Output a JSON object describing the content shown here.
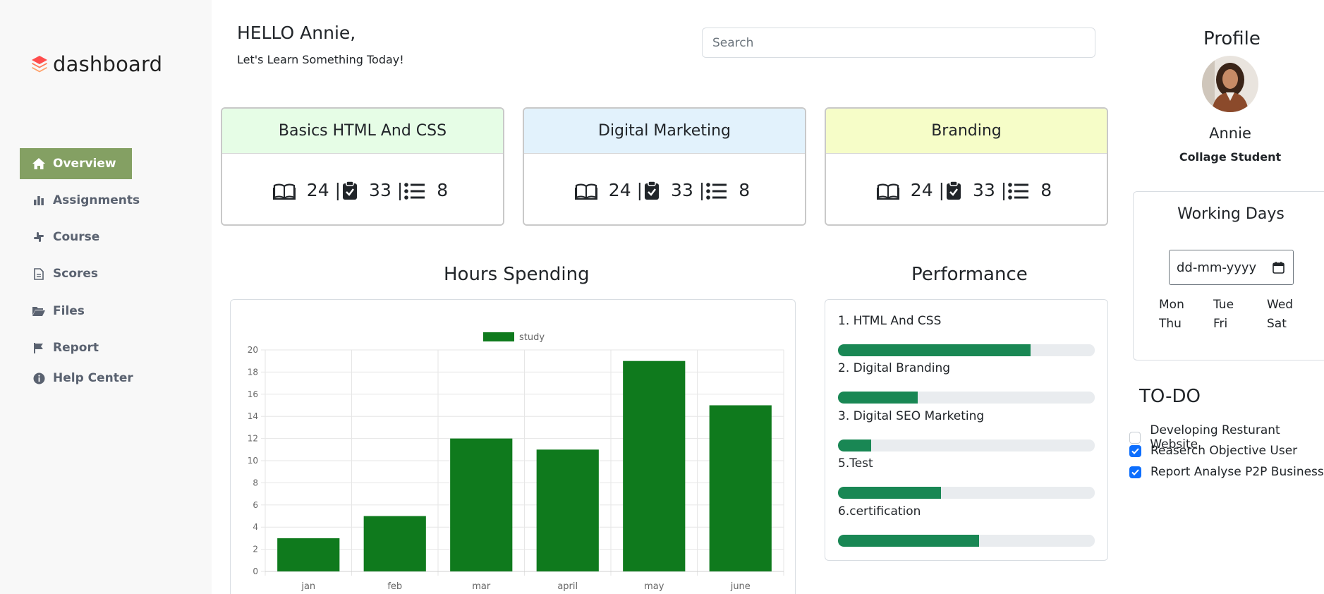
{
  "sidebar": {
    "logo_text": "dashboard",
    "items": [
      {
        "label": "Overview",
        "icon": "home-icon",
        "active": true
      },
      {
        "label": "Assignments",
        "icon": "bar-chart-icon"
      },
      {
        "label": "Course",
        "icon": "slack-icon"
      },
      {
        "label": "Scores",
        "icon": "document-icon"
      },
      {
        "label": "Files",
        "icon": "folder-open-icon"
      },
      {
        "label": "Report",
        "icon": "flag-icon"
      },
      {
        "label": "Help Center",
        "icon": "info-circle-icon"
      }
    ]
  },
  "header": {
    "greeting": "HELLO Annie,",
    "subtitle": "Let's Learn Something Today!",
    "search_placeholder": "Search"
  },
  "courses": [
    {
      "title": "Basics HTML And CSS",
      "head_color": "#e6fde6",
      "lessons": "24",
      "assignments": "33",
      "items": "8"
    },
    {
      "title": "Digital Marketing",
      "head_color": "#e2f2fc",
      "lessons": "24",
      "assignments": "33",
      "items": "8"
    },
    {
      "title": "Branding",
      "head_color": "#f6fdc8",
      "lessons": "24",
      "assignments": "33",
      "items": "8"
    }
  ],
  "separator": "|",
  "hours_title": "Hours Spending",
  "chart_data": {
    "type": "bar",
    "categories": [
      "jan",
      "feb",
      "mar",
      "april",
      "may",
      "june"
    ],
    "series": [
      {
        "name": "study",
        "values": [
          3,
          5,
          12,
          11,
          19,
          15
        ],
        "color": "#0f7a1d"
      }
    ],
    "ylim": [
      0,
      20
    ],
    "yticks": [
      "0",
      "2",
      "4",
      "6",
      "8",
      "10",
      "12",
      "14",
      "16",
      "18",
      "20"
    ],
    "grid": true,
    "legend": "top"
  },
  "performance": {
    "title": "Performance",
    "items": [
      {
        "label": "1. HTML And CSS",
        "progress": 0.75
      },
      {
        "label": "2. Digital Branding",
        "progress": 0.31
      },
      {
        "label": "3. Digital SEO Marketing",
        "progress": 0.13
      },
      {
        "label": "5.Test",
        "progress": 0.4
      },
      {
        "label": "6.certification",
        "progress": 0.55
      }
    ]
  },
  "profile": {
    "title": "Profile",
    "name": "Annie",
    "role": "Collage Student"
  },
  "working_days": {
    "title": "Working Days",
    "date_value": "dd-mm-yyyy",
    "days": [
      "Mon",
      "Tue",
      "Wed",
      "Thu",
      "Fri",
      "Sat"
    ]
  },
  "todo": {
    "title": "TO-DO",
    "items": [
      {
        "label": "Developing Resturant Website",
        "checked": false
      },
      {
        "label": "Reaserch Objective User",
        "checked": true
      },
      {
        "label": "Report Analyse P2P Business",
        "checked": true
      }
    ]
  }
}
